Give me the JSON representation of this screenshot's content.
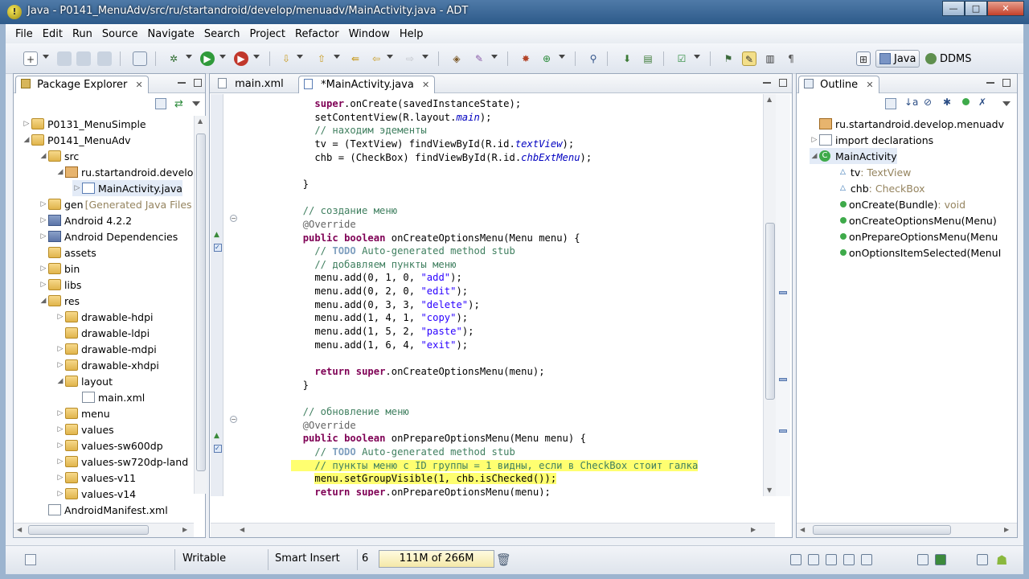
{
  "window": {
    "title": "Java - P0141_MenuAdv/src/ru/startandroid/develop/menuadv/MainActivity.java - ADT",
    "controls": [
      "—",
      "□",
      "✕"
    ]
  },
  "menubar": [
    "File",
    "Edit",
    "Run",
    "Source",
    "Navigate",
    "Search",
    "Project",
    "Refactor",
    "Window",
    "Help"
  ],
  "perspectives": [
    {
      "label": "Java",
      "active": true
    },
    {
      "label": "DDMS",
      "active": false
    }
  ],
  "package_explorer": {
    "title": "Package Explorer",
    "items": [
      {
        "label": "P0131_MenuSimple",
        "icon": "project"
      },
      {
        "label": "P0141_MenuAdv",
        "icon": "project"
      },
      {
        "label": "src",
        "icon": "folder"
      },
      {
        "label": "ru.startandroid.develo",
        "icon": "package"
      },
      {
        "label": "MainActivity.java",
        "icon": "java-file"
      },
      {
        "label": "gen",
        "suffix": "[Generated Java Files",
        "icon": "folder"
      },
      {
        "label": "Android 4.2.2",
        "icon": "library"
      },
      {
        "label": "Android Dependencies",
        "icon": "library"
      },
      {
        "label": "assets",
        "icon": "folder"
      },
      {
        "label": "bin",
        "icon": "folder"
      },
      {
        "label": "libs",
        "icon": "folder"
      },
      {
        "label": "res",
        "icon": "folder"
      },
      {
        "label": "drawable-hdpi",
        "icon": "folder"
      },
      {
        "label": "drawable-ldpi",
        "icon": "folder"
      },
      {
        "label": "drawable-mdpi",
        "icon": "folder"
      },
      {
        "label": "drawable-xhdpi",
        "icon": "folder"
      },
      {
        "label": "layout",
        "icon": "folder"
      },
      {
        "label": "main.xml",
        "icon": "xml-file"
      },
      {
        "label": "menu",
        "icon": "folder"
      },
      {
        "label": "values",
        "icon": "folder"
      },
      {
        "label": "values-sw600dp",
        "icon": "folder"
      },
      {
        "label": "values-sw720dp-land",
        "icon": "folder"
      },
      {
        "label": "values-v11",
        "icon": "folder"
      },
      {
        "label": "values-v14",
        "icon": "folder"
      },
      {
        "label": "AndroidManifest.xml",
        "icon": "xml-file"
      }
    ]
  },
  "editor": {
    "tabs": [
      {
        "label": "main.xml",
        "active": false
      },
      {
        "label": "*MainActivity.java",
        "active": true
      }
    ],
    "lines": [
      "    super.onCreate(savedInstanceState);",
      "    setContentView(R.layout.main);",
      "    // находим эдементы",
      "    tv = (TextView) findViewById(R.id.textView);",
      "    chb = (CheckBox) findViewById(R.id.chbExtMenu);",
      "",
      "  }",
      "",
      "  // создание меню",
      "  @Override",
      "  public boolean onCreateOptionsMenu(Menu menu) {",
      "    // TODO Auto-generated method stub",
      "    // добавляем пункты меню",
      "    menu.add(0, 1, 0, \"add\");",
      "    menu.add(0, 2, 0, \"edit\");",
      "    menu.add(0, 3, 3, \"delete\");",
      "    menu.add(1, 4, 1, \"copy\");",
      "    menu.add(1, 5, 2, \"paste\");",
      "    menu.add(1, 6, 4, \"exit\");",
      "",
      "    return super.onCreateOptionsMenu(menu);",
      "  }",
      "",
      "  // обновление меню",
      "  @Override",
      "  public boolean onPrepareOptionsMenu(Menu menu) {",
      "    // TODO Auto-generated method stub",
      "    // пункты меню с ID группы = 1 видны, если в CheckBox стоит галка",
      "    menu.setGroupVisible(1, chb.isChecked());",
      "    return super.onPrepareOptionsMenu(menu);",
      "  }"
    ]
  },
  "outline": {
    "title": "Outline",
    "items": [
      {
        "label": "ru.startandroid.develop.menuadv",
        "type": ""
      },
      {
        "label": "import declarations",
        "type": ""
      },
      {
        "label": "MainActivity",
        "type": ""
      },
      {
        "label": "tv",
        "type": " : TextView"
      },
      {
        "label": "chb",
        "type": " : CheckBox"
      },
      {
        "label": "onCreate(Bundle)",
        "type": " : void"
      },
      {
        "label": "onCreateOptionsMenu(Menu)",
        "type": ""
      },
      {
        "label": "onPrepareOptionsMenu(Menu",
        "type": ""
      },
      {
        "label": "onOptionsItemSelected(MenuI",
        "type": ""
      }
    ]
  },
  "statusbar": {
    "writable": "Writable",
    "insert_mode": "Smart Insert",
    "position": "6",
    "heap": "111M of 266M"
  }
}
